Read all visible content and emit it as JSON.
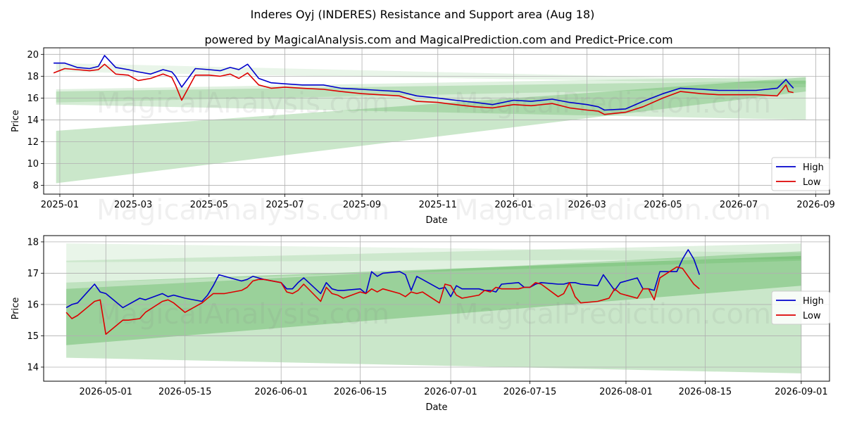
{
  "title": "Inderes Oyj (INDERES) Resistance and Support area (Aug 18)",
  "subtitle": "powered by MagicalAnalysis.com and MagicalPrediction.com and Predict-Price.com",
  "watermark_left": "MagicalAnalysis.com",
  "watermark_right": "MagicalPrediction.com",
  "colors": {
    "high": "#0000cc",
    "low": "#dd0000",
    "band": "#2ca02c",
    "grid": "#b0b0b0"
  },
  "chart_data": [
    {
      "type": "line",
      "xlabel": "Date",
      "ylabel": "Price",
      "xlim": [
        "2024-12-19",
        "2026-09-12"
      ],
      "ylim": [
        7.2,
        20.6
      ],
      "xticks": [
        "2025-01",
        "2025-03",
        "2025-05",
        "2025-07",
        "2025-09",
        "2025-11",
        "2026-01",
        "2026-03",
        "2026-05",
        "2026-07",
        "2026-09"
      ],
      "yticks": [
        8,
        10,
        12,
        14,
        16,
        18,
        20
      ],
      "grid": true,
      "legend_position": "lower right",
      "bands": [
        {
          "x": [
            "2024-12-29",
            "2026-08-24"
          ],
          "upper": [
            19.2,
            17.6
          ],
          "lower": [
            18.4,
            17.3
          ],
          "opacity": 0.1
        },
        {
          "x": [
            "2024-12-29",
            "2026-08-24"
          ],
          "upper": [
            16.8,
            18.0
          ],
          "lower": [
            15.6,
            17.0
          ],
          "opacity": 0.15
        },
        {
          "x": [
            "2024-12-29",
            "2026-08-24"
          ],
          "upper": [
            13.0,
            17.9
          ],
          "lower": [
            8.2,
            16.6
          ],
          "opacity": 0.25
        },
        {
          "x": [
            "2024-12-29",
            "2026-08-24"
          ],
          "upper": [
            16.6,
            17.6
          ],
          "lower": [
            15.4,
            14.0
          ],
          "opacity": 0.2
        }
      ],
      "series": [
        {
          "name": "High",
          "x": [
            "2024-12-27",
            "2025-01-05",
            "2025-01-15",
            "2025-01-25",
            "2025-02-01",
            "2025-02-06",
            "2025-02-15",
            "2025-02-25",
            "2025-03-05",
            "2025-03-15",
            "2025-03-25",
            "2025-04-01",
            "2025-04-04",
            "2025-04-09",
            "2025-04-20",
            "2025-05-01",
            "2025-05-10",
            "2025-05-18",
            "2025-05-25",
            "2025-06-01",
            "2025-06-10",
            "2025-06-20",
            "2025-07-01",
            "2025-07-15",
            "2025-08-01",
            "2025-08-15",
            "2025-09-01",
            "2025-09-15",
            "2025-10-01",
            "2025-10-15",
            "2025-11-01",
            "2025-11-15",
            "2025-12-01",
            "2025-12-15",
            "2026-01-01",
            "2026-01-15",
            "2026-02-01",
            "2026-02-15",
            "2026-03-01",
            "2026-03-10",
            "2026-03-15",
            "2026-04-01",
            "2026-04-15",
            "2026-05-01",
            "2026-05-15",
            "2026-06-01",
            "2026-06-15",
            "2026-07-01",
            "2026-07-15",
            "2026-08-01",
            "2026-08-08",
            "2026-08-10",
            "2026-08-14"
          ],
          "values": [
            19.2,
            19.2,
            18.8,
            18.7,
            18.9,
            19.9,
            18.8,
            18.6,
            18.4,
            18.2,
            18.6,
            18.4,
            18.0,
            17.0,
            18.7,
            18.6,
            18.5,
            18.8,
            18.6,
            19.1,
            17.8,
            17.4,
            17.3,
            17.2,
            17.2,
            16.9,
            16.8,
            16.7,
            16.6,
            16.2,
            16.0,
            15.8,
            15.6,
            15.4,
            15.8,
            15.7,
            15.9,
            15.6,
            15.4,
            15.2,
            14.9,
            15.0,
            15.7,
            16.4,
            16.9,
            16.8,
            16.7,
            16.7,
            16.7,
            16.9,
            17.7,
            17.4,
            16.9
          ]
        },
        {
          "name": "Low",
          "x": [
            "2024-12-27",
            "2025-01-05",
            "2025-01-15",
            "2025-01-25",
            "2025-02-01",
            "2025-02-06",
            "2025-02-15",
            "2025-02-25",
            "2025-03-05",
            "2025-03-15",
            "2025-03-25",
            "2025-04-01",
            "2025-04-04",
            "2025-04-09",
            "2025-04-20",
            "2025-05-01",
            "2025-05-10",
            "2025-05-18",
            "2025-05-25",
            "2025-06-01",
            "2025-06-10",
            "2025-06-20",
            "2025-07-01",
            "2025-07-15",
            "2025-08-01",
            "2025-08-15",
            "2025-09-01",
            "2025-09-15",
            "2025-10-01",
            "2025-10-15",
            "2025-11-01",
            "2025-11-15",
            "2025-12-01",
            "2025-12-15",
            "2026-01-01",
            "2026-01-15",
            "2026-02-01",
            "2026-02-15",
            "2026-03-01",
            "2026-03-10",
            "2026-03-15",
            "2026-04-01",
            "2026-04-15",
            "2026-05-01",
            "2026-05-15",
            "2026-06-01",
            "2026-06-15",
            "2026-07-01",
            "2026-07-15",
            "2026-08-01",
            "2026-08-08",
            "2026-08-10",
            "2026-08-14"
          ],
          "values": [
            18.3,
            18.7,
            18.6,
            18.5,
            18.6,
            19.1,
            18.2,
            18.1,
            17.6,
            17.8,
            18.2,
            17.9,
            17.2,
            15.8,
            18.1,
            18.1,
            18.0,
            18.2,
            17.8,
            18.3,
            17.2,
            16.9,
            17.0,
            16.9,
            16.8,
            16.6,
            16.4,
            16.3,
            16.2,
            15.7,
            15.6,
            15.4,
            15.2,
            15.1,
            15.4,
            15.3,
            15.5,
            15.1,
            14.9,
            14.8,
            14.5,
            14.7,
            15.2,
            16.0,
            16.6,
            16.4,
            16.3,
            16.3,
            16.3,
            16.2,
            17.2,
            16.6,
            16.5
          ]
        }
      ]
    },
    {
      "type": "line",
      "xlabel": "Date",
      "ylabel": "Price",
      "xlim": [
        "2026-04-20",
        "2026-09-06"
      ],
      "ylim": [
        13.55,
        18.2
      ],
      "xticks": [
        "2026-05-01",
        "2026-05-15",
        "2026-06-01",
        "2026-06-15",
        "2026-07-01",
        "2026-07-15",
        "2026-08-01",
        "2026-08-15",
        "2026-09-01"
      ],
      "yticks": [
        14,
        15,
        16,
        17,
        18
      ],
      "grid": true,
      "legend_position": "center right",
      "bands": [
        {
          "x": [
            "2026-04-24",
            "2026-09-01"
          ],
          "upper": [
            17.95,
            17.65
          ],
          "lower": [
            17.35,
            17.45
          ],
          "opacity": 0.1
        },
        {
          "x": [
            "2026-04-24",
            "2026-09-01"
          ],
          "upper": [
            17.4,
            17.95
          ],
          "lower": [
            16.7,
            17.4
          ],
          "opacity": 0.15
        },
        {
          "x": [
            "2026-04-24",
            "2026-09-01"
          ],
          "upper": [
            16.7,
            17.55
          ],
          "lower": [
            14.7,
            16.6
          ],
          "opacity": 0.3
        },
        {
          "x": [
            "2026-04-24",
            "2026-09-01"
          ],
          "upper": [
            16.5,
            17.7
          ],
          "lower": [
            14.3,
            13.8
          ],
          "opacity": 0.25
        }
      ],
      "series": [
        {
          "name": "High",
          "x": [
            "2026-04-24",
            "2026-04-25",
            "2026-04-26",
            "2026-04-29",
            "2026-04-30",
            "2026-05-01",
            "2026-05-04",
            "2026-05-05",
            "2026-05-07",
            "2026-05-08",
            "2026-05-11",
            "2026-05-12",
            "2026-05-13",
            "2026-05-15",
            "2026-05-18",
            "2026-05-19",
            "2026-05-20",
            "2026-05-21",
            "2026-05-22",
            "2026-05-25",
            "2026-05-26",
            "2026-05-27",
            "2026-05-28",
            "2026-05-29",
            "2026-06-01",
            "2026-06-02",
            "2026-06-03",
            "2026-06-04",
            "2026-06-05",
            "2026-06-08",
            "2026-06-09",
            "2026-06-10",
            "2026-06-11",
            "2026-06-12",
            "2026-06-15",
            "2026-06-16",
            "2026-06-17",
            "2026-06-18",
            "2026-06-19",
            "2026-06-22",
            "2026-06-23",
            "2026-06-24",
            "2026-06-25",
            "2026-06-26",
            "2026-06-29",
            "2026-06-30",
            "2026-07-01",
            "2026-07-02",
            "2026-07-03",
            "2026-07-06",
            "2026-07-07",
            "2026-07-08",
            "2026-07-09",
            "2026-07-10",
            "2026-07-13",
            "2026-07-14",
            "2026-07-15",
            "2026-07-16",
            "2026-07-17",
            "2026-07-20",
            "2026-07-21",
            "2026-07-22",
            "2026-07-23",
            "2026-07-24",
            "2026-07-27",
            "2026-07-28",
            "2026-07-29",
            "2026-07-30",
            "2026-07-31",
            "2026-08-03",
            "2026-08-04",
            "2026-08-05",
            "2026-08-06",
            "2026-08-07",
            "2026-08-10",
            "2026-08-11",
            "2026-08-12",
            "2026-08-13",
            "2026-08-14"
          ],
          "values": [
            15.9,
            16.0,
            16.05,
            16.65,
            16.4,
            16.35,
            15.9,
            16.0,
            16.2,
            16.15,
            16.35,
            16.25,
            16.3,
            16.2,
            16.1,
            16.3,
            16.6,
            16.95,
            16.9,
            16.75,
            16.8,
            16.9,
            16.85,
            16.8,
            16.7,
            16.5,
            16.5,
            16.7,
            16.85,
            16.35,
            16.7,
            16.5,
            16.45,
            16.45,
            16.5,
            16.35,
            17.05,
            16.9,
            17.0,
            17.05,
            16.95,
            16.45,
            16.9,
            16.8,
            16.5,
            16.55,
            16.25,
            16.6,
            16.5,
            16.5,
            16.45,
            16.45,
            16.4,
            16.65,
            16.7,
            16.55,
            16.55,
            16.65,
            16.7,
            16.65,
            16.65,
            16.7,
            16.7,
            16.65,
            16.6,
            16.95,
            16.7,
            16.45,
            16.7,
            16.85,
            16.5,
            16.5,
            16.45,
            17.05,
            17.05,
            17.45,
            17.75,
            17.45,
            16.95
          ]
        },
        {
          "name": "Low",
          "x": [
            "2026-04-24",
            "2026-04-25",
            "2026-04-26",
            "2026-04-29",
            "2026-04-30",
            "2026-05-01",
            "2026-05-04",
            "2026-05-05",
            "2026-05-07",
            "2026-05-08",
            "2026-05-11",
            "2026-05-12",
            "2026-05-13",
            "2026-05-15",
            "2026-05-18",
            "2026-05-19",
            "2026-05-20",
            "2026-05-21",
            "2026-05-22",
            "2026-05-25",
            "2026-05-26",
            "2026-05-27",
            "2026-05-28",
            "2026-05-29",
            "2026-06-01",
            "2026-06-02",
            "2026-06-03",
            "2026-06-04",
            "2026-06-05",
            "2026-06-08",
            "2026-06-09",
            "2026-06-10",
            "2026-06-11",
            "2026-06-12",
            "2026-06-15",
            "2026-06-16",
            "2026-06-17",
            "2026-06-18",
            "2026-06-19",
            "2026-06-22",
            "2026-06-23",
            "2026-06-24",
            "2026-06-25",
            "2026-06-26",
            "2026-06-29",
            "2026-06-30",
            "2026-07-01",
            "2026-07-02",
            "2026-07-03",
            "2026-07-06",
            "2026-07-07",
            "2026-07-08",
            "2026-07-09",
            "2026-07-10",
            "2026-07-13",
            "2026-07-14",
            "2026-07-15",
            "2026-07-16",
            "2026-07-17",
            "2026-07-20",
            "2026-07-21",
            "2026-07-22",
            "2026-07-23",
            "2026-07-24",
            "2026-07-27",
            "2026-07-28",
            "2026-07-29",
            "2026-07-30",
            "2026-07-31",
            "2026-08-03",
            "2026-08-04",
            "2026-08-05",
            "2026-08-06",
            "2026-08-07",
            "2026-08-10",
            "2026-08-11",
            "2026-08-12",
            "2026-08-13",
            "2026-08-14"
          ],
          "values": [
            15.75,
            15.55,
            15.65,
            16.1,
            16.15,
            15.05,
            15.5,
            15.5,
            15.55,
            15.75,
            16.1,
            16.15,
            16.05,
            15.75,
            16.05,
            16.2,
            16.35,
            16.35,
            16.35,
            16.45,
            16.55,
            16.75,
            16.8,
            16.8,
            16.7,
            16.4,
            16.35,
            16.45,
            16.65,
            16.1,
            16.55,
            16.35,
            16.3,
            16.2,
            16.4,
            16.35,
            16.5,
            16.4,
            16.5,
            16.35,
            16.25,
            16.4,
            16.35,
            16.4,
            16.05,
            16.65,
            16.6,
            16.3,
            16.2,
            16.3,
            16.45,
            16.4,
            16.55,
            16.5,
            16.5,
            16.55,
            16.55,
            16.7,
            16.65,
            16.25,
            16.35,
            16.7,
            16.25,
            16.05,
            16.1,
            16.15,
            16.2,
            16.5,
            16.35,
            16.2,
            16.5,
            16.5,
            16.15,
            16.85,
            17.2,
            17.15,
            16.9,
            16.65,
            16.5
          ]
        }
      ]
    }
  ]
}
